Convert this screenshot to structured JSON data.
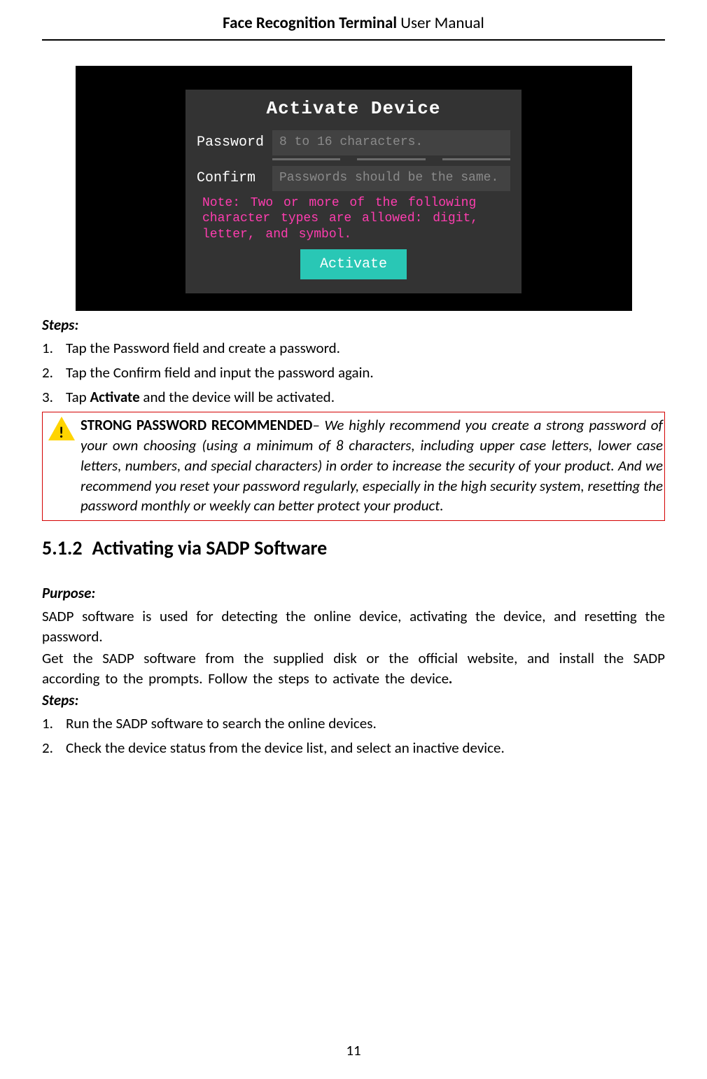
{
  "header": {
    "bold": "Face Recognition Terminal",
    "rest": " User Manual"
  },
  "screenshot": {
    "dialog_title": "Activate Device",
    "password_label": "Password",
    "password_placeholder": "8 to 16 characters.",
    "confirm_label": "Confirm",
    "confirm_placeholder": "Passwords should be the same.",
    "note_text": "Note: Two or more of the following character types are allowed: digit, letter, and symbol.",
    "activate_button": "Activate"
  },
  "steps_label_1": "Steps:",
  "steps_1": [
    "Tap the Password field and create a password.",
    "Tap the Confirm field and input the password again."
  ],
  "step_3_prefix": "Tap ",
  "step_3_bold": "Activate",
  "step_3_suffix": " and the device will be activated.",
  "callout": {
    "lead": "STRONG PASSWORD RECOMMENDED",
    "body": "– We highly recommend you create a strong password of your own choosing (using a minimum of 8 characters, including upper case letters, lower case letters, numbers, and special characters) in order to increase the security of your product. And we recommend you reset your password regularly, especially in the high security system, resetting the password monthly or weekly can better protect your product."
  },
  "h512_num": "5.1.2",
  "h512_title": "Activating via SADP Software",
  "purpose_label": "Purpose:",
  "purpose_p1": "SADP software is used for detecting the online device, activating the device, and resetting the password.",
  "purpose_p2_prefix": "Get the SADP software from the supplied disk or the official website, and install the SADP according to the prompts. Follow the steps to activate the device",
  "purpose_p2_bold_period": ".",
  "steps_label_2": "Steps:",
  "steps_2": [
    "Run the SADP software to search the online devices.",
    "Check the device status from the device list, and select an inactive device."
  ],
  "page_number": "11"
}
